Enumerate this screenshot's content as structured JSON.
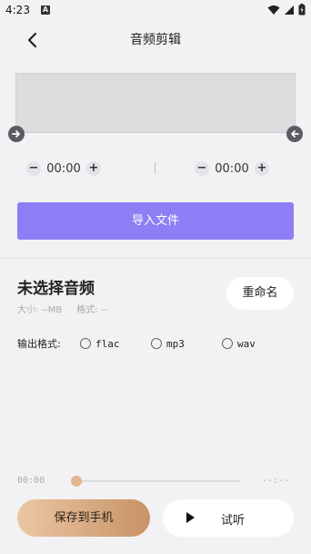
{
  "status": {
    "time": "4:23",
    "notification_letter": "A",
    "icons": [
      "wifi-icon",
      "signal-icon",
      "battery-icon"
    ]
  },
  "header": {
    "title": "音频剪辑",
    "back_icon": "chevron-left-icon"
  },
  "trim": {
    "start_time": "00:00",
    "end_time": "00:00",
    "minus": "−",
    "plus": "+"
  },
  "import_label": "导入文件",
  "file": {
    "title": "未选择音频",
    "size_text": "大小: --MB",
    "format_text": "格式: --",
    "rename_label": "重命名"
  },
  "output": {
    "label": "输出格式:",
    "options": [
      "flac",
      "mp3",
      "wav"
    ],
    "selected": null
  },
  "playback": {
    "current": "00:00",
    "total": "--:--",
    "progress": 0
  },
  "actions": {
    "save_label": "保存到手机",
    "listen_label": "试听"
  },
  "colors": {
    "accent": "#8d7ef5",
    "save_gradient_start": "#ebc6a3",
    "save_gradient_end": "#c89366",
    "thumb": "#e3b58f"
  }
}
